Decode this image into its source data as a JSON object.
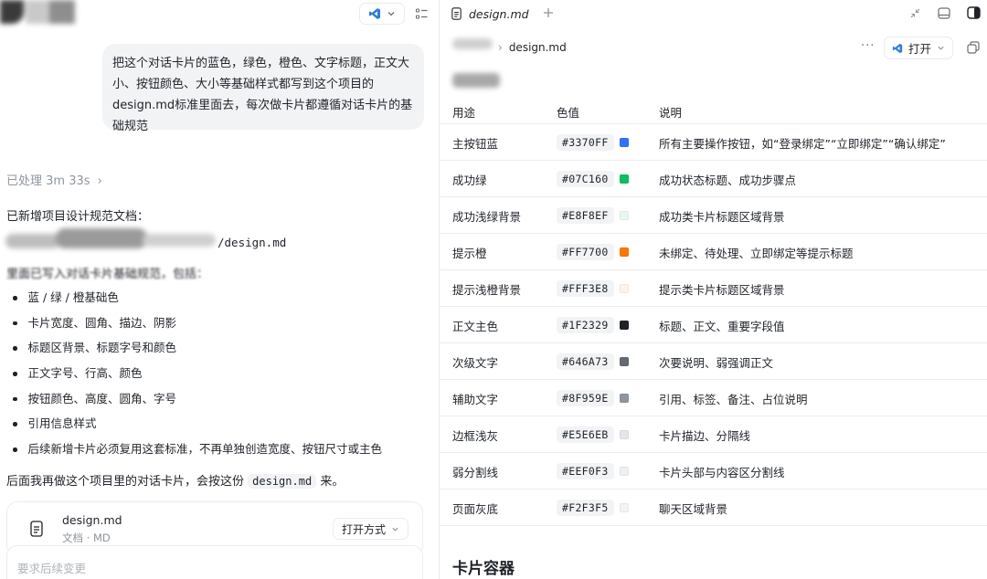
{
  "left_panel": {
    "user_message": "把这个对话卡片的蓝色，绿色，橙色、文字标题，正文大小、按钮颜色、大小等基础样式都写到这个项目的design.md标准里面去，每次做卡片都遵循对话卡片的基础规范",
    "processed": "已处理 3m 33s",
    "added_doc": "已新增项目设计规范文档：",
    "doc_path": "/design.md",
    "includes_intro": "里面已写入对话卡片基础规范，包括：",
    "bullets": [
      "蓝 / 绿 / 橙基础色",
      "卡片宽度、圆角、描边、阴影",
      "标题区背景、标题字号和颜色",
      "正文字号、行高、颜色",
      "按钮颜色、高度、圆角、字号",
      "引用信息样式",
      "后续新增卡片必须复用这套标准，不再单独创造宽度、按钮尺寸或主色"
    ],
    "closing_before": "后面我再做这个项目里的对话卡片，会按这份",
    "closing_code": "design.md",
    "closing_after": "来。",
    "file_card": {
      "name": "design.md",
      "meta": "文档 · MD",
      "open_with": "打开方式"
    },
    "input_placeholder": "要求后续变更"
  },
  "right_panel": {
    "tab_title": "design.md",
    "breadcrumb_file": "design.md",
    "open_button": "打开",
    "table": {
      "headers": [
        "用途",
        "色值",
        "说明"
      ],
      "rows": [
        {
          "usage": "主按钮蓝",
          "hex": "#3370FF",
          "color": "#3370FF",
          "desc": "所有主要操作按钮，如“登录绑定”“立即绑定”“确认绑定”"
        },
        {
          "usage": "成功绿",
          "hex": "#07C160",
          "color": "#07C160",
          "desc": "成功状态标题、成功步骤点"
        },
        {
          "usage": "成功浅绿背景",
          "hex": "#E8F8EF",
          "color": "#E8F8EF",
          "desc": "成功类卡片标题区域背景"
        },
        {
          "usage": "提示橙",
          "hex": "#FF7700",
          "color": "#FF7700",
          "desc": "未绑定、待处理、立即绑定等提示标题"
        },
        {
          "usage": "提示浅橙背景",
          "hex": "#FFF3E8",
          "color": "#FFF3E8",
          "desc": "提示类卡片标题区域背景"
        },
        {
          "usage": "正文主色",
          "hex": "#1F2329",
          "color": "#1F2329",
          "desc": "标题、正文、重要字段值"
        },
        {
          "usage": "次级文字",
          "hex": "#646A73",
          "color": "#646A73",
          "desc": "次要说明、弱强调正文"
        },
        {
          "usage": "辅助文字",
          "hex": "#8F959E",
          "color": "#8F959E",
          "desc": "引用、标签、备注、占位说明"
        },
        {
          "usage": "边框浅灰",
          "hex": "#E5E6EB",
          "color": "#E5E6EB",
          "desc": "卡片描边、分隔线"
        },
        {
          "usage": "弱分割线",
          "hex": "#EEF0F3",
          "color": "#EEF0F3",
          "desc": "卡片头部与内容区分割线"
        },
        {
          "usage": "页面灰底",
          "hex": "#F2F3F5",
          "color": "#F2F3F5",
          "desc": "聊天区域背景"
        }
      ]
    },
    "section_heading": "卡片容器"
  }
}
